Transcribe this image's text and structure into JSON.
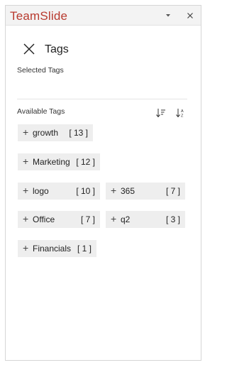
{
  "app": {
    "title": "TeamSlide",
    "menu_icon": "chevron-down-icon",
    "close_icon": "close-icon",
    "accent_color": "#b83a2f"
  },
  "header": {
    "close_icon": "close-icon",
    "title": "Tags"
  },
  "selected": {
    "label": "Selected Tags"
  },
  "available": {
    "label": "Available Tags",
    "sort_by_count_icon": "sort-descending-icon",
    "sort_alpha_icon": "sort-alphabetical-icon"
  },
  "tags": [
    {
      "name": "growth",
      "count": "[ 13 ]"
    },
    {
      "name": "Marketing",
      "count": "[ 12 ]"
    },
    {
      "name": "logo",
      "count": "[ 10 ]"
    },
    {
      "name": "365",
      "count": "[ 7 ]"
    },
    {
      "name": "Office",
      "count": "[ 7 ]"
    },
    {
      "name": "q2",
      "count": "[ 3 ]"
    },
    {
      "name": "Financials",
      "count": "[ 1 ]"
    }
  ]
}
